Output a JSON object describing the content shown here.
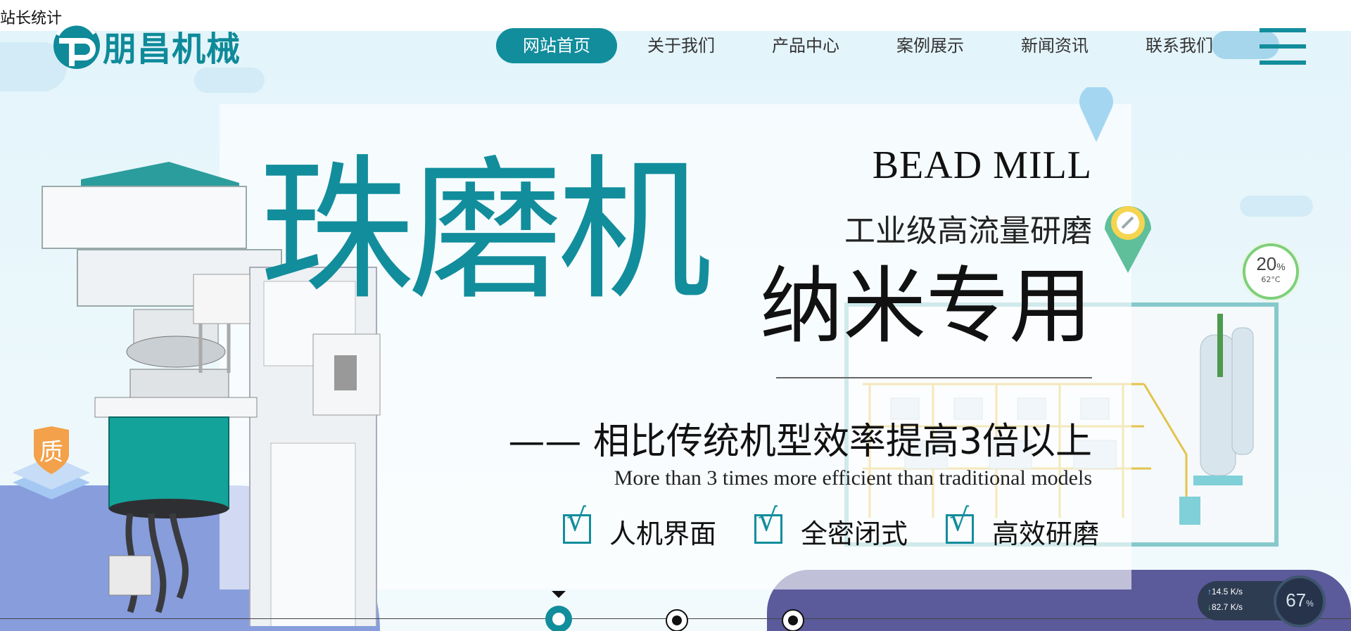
{
  "stat_link": "站长统计",
  "brand": {
    "name": "朋昌机械",
    "color": "#0e8a99"
  },
  "nav": {
    "items": [
      {
        "label": "网站首页",
        "active": true
      },
      {
        "label": "关于我们",
        "active": false
      },
      {
        "label": "产品中心",
        "active": false
      },
      {
        "label": "案例展示",
        "active": false
      },
      {
        "label": "新闻资讯",
        "active": false
      },
      {
        "label": "联系我们",
        "active": false
      }
    ],
    "accent": "#128d9c"
  },
  "banner": {
    "title_cn": "珠磨机",
    "title_en": "BEAD MILL",
    "subtitle_cn": "工业级高流量研磨",
    "title_nano": "纳米专用",
    "slogan_cn": "—— 相比传统机型效率提高3倍以上",
    "slogan_en": "More than 3 times more efficient than traditional models",
    "features": [
      "人机界面",
      "全密闭式",
      "高效研磨"
    ],
    "check_glyph": "√",
    "badge_text": "质"
  },
  "slider": {
    "slide_count": 3,
    "active_index": 0
  },
  "widgets": {
    "cpu_percent": "20",
    "cpu_unit": "%",
    "cpu_temp": "62°C",
    "net_up": "14.5",
    "net_up_unit": "K/s",
    "net_down": "82.7",
    "net_down_unit": "K/s",
    "mem_percent": "67",
    "mem_unit": "%"
  },
  "icons": {
    "menu": "menu-icon",
    "check": "check-icon",
    "quality_badge": "quality-badge-icon",
    "location_pin": "location-pin-icon"
  }
}
